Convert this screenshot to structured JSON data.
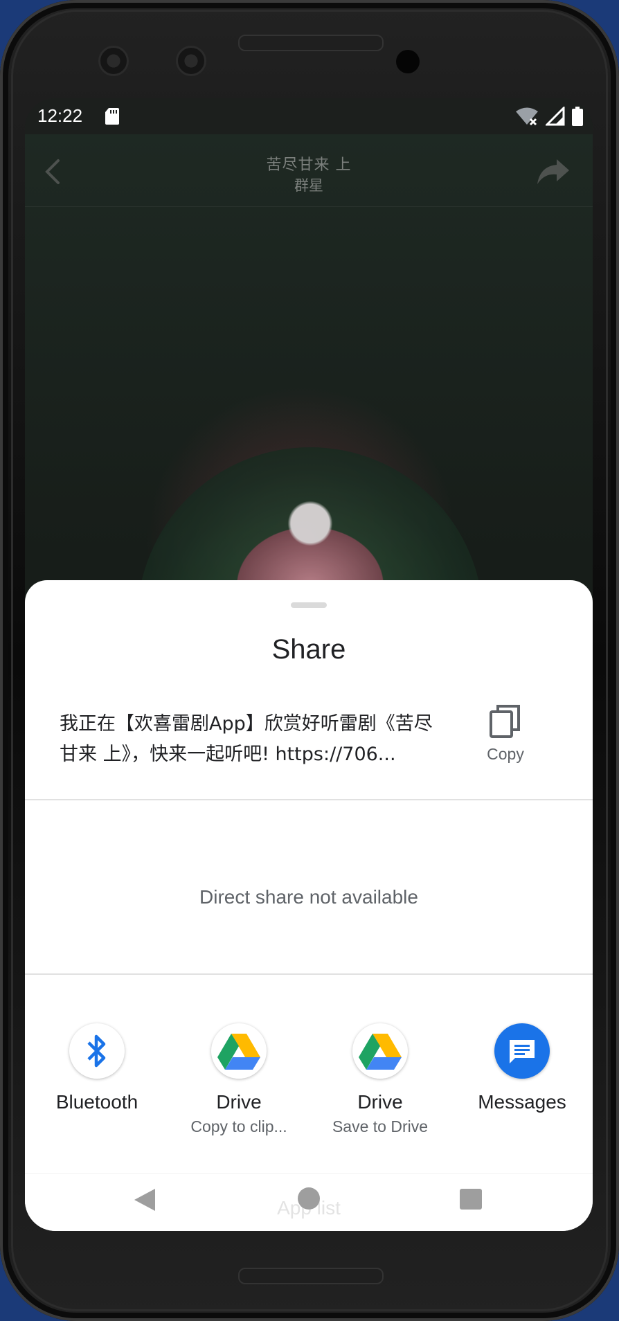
{
  "status_bar": {
    "time": "12:22"
  },
  "app_bar": {
    "title": "苦尽甘来  上",
    "subtitle": "群星"
  },
  "share_sheet": {
    "title": "Share",
    "share_text": "我正在【欢喜雷剧App】欣赏好听雷剧《苦尽甘来  上》，快来一起听吧! https://706...",
    "copy_label": "Copy",
    "direct_share_message": "Direct share not available",
    "targets": [
      {
        "label": "Bluetooth",
        "sublabel": "",
        "icon": "bluetooth-icon"
      },
      {
        "label": "Drive",
        "sublabel": "Copy to clip...",
        "icon": "google-drive-icon"
      },
      {
        "label": "Drive",
        "sublabel": "Save to Drive",
        "icon": "google-drive-icon"
      },
      {
        "label": "Messages",
        "sublabel": "",
        "icon": "messages-icon"
      }
    ],
    "app_list_label": "App list"
  },
  "colors": {
    "bluetooth_blue": "#1a73e8",
    "messages_blue": "#1a73e8",
    "drive_green": "#1ea362",
    "drive_yellow": "#ffba00",
    "drive_blue": "#4285f4"
  }
}
